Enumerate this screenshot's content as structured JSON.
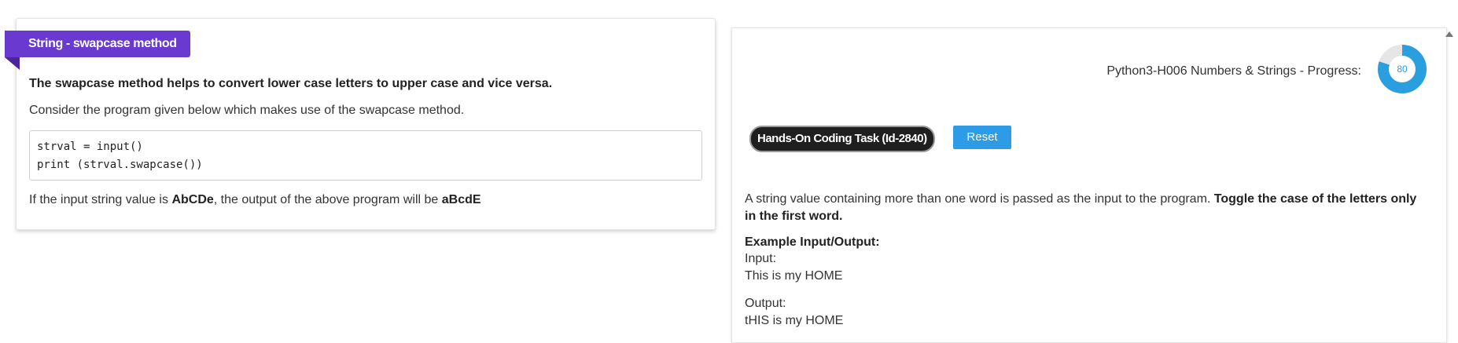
{
  "left_card": {
    "ribbon_title": "String - swapcase method",
    "intro_bold": "The swapcase method helps to convert lower case letters to upper case and vice versa.",
    "consider_text": "Consider the program given below which makes use of the swapcase method.",
    "code_lines": [
      "strval = input()",
      "print (strval.swapcase())"
    ],
    "output_prefix": "If the input string value is ",
    "input_example": "AbCDe",
    "output_middle": ", the output of the above program will be ",
    "output_example": "aBcdE"
  },
  "right_panel": {
    "progress_label": "Python3-H006 Numbers & Strings - Progress:",
    "progress_value": "80",
    "progress_fraction": 0.8,
    "task_badge": "Hands-On Coding Task (Id-2840)",
    "reset_label": "Reset",
    "desc_plain": "A string value containing more than one word is passed as the input to the program. ",
    "desc_bold": "Toggle the case of the letters only in the first word.",
    "example_heading": "Example Input/Output:",
    "input_label": "Input:",
    "input_value": "This is my HOME",
    "output_label": "Output:",
    "output_value": "tHIS is my HOME"
  },
  "colors": {
    "ribbon": "#6a3ad0",
    "reset_button": "#2e9be6",
    "progress_ring": "#2a9fe0",
    "task_badge_bg": "#1f1f1f"
  }
}
